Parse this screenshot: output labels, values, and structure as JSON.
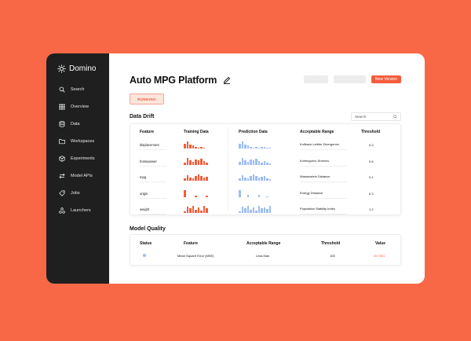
{
  "app": {
    "name": "Domino"
  },
  "sidebar": {
    "items": [
      {
        "label": "Search",
        "icon": "search-icon"
      },
      {
        "label": "Overview",
        "icon": "grid-icon"
      },
      {
        "label": "Data",
        "icon": "database-icon"
      },
      {
        "label": "Workspaces",
        "icon": "folder-icon"
      },
      {
        "label": "Experiments",
        "icon": "cube-icon"
      },
      {
        "label": "Model APIs",
        "icon": "arrows-icon"
      },
      {
        "label": "Jobs",
        "icon": "tag-icon"
      },
      {
        "label": "Launchers",
        "icon": "launcher-icon"
      }
    ]
  },
  "header": {
    "title": "Auto MPG Platform",
    "status": "RUNNING",
    "new_version_label": "New Version"
  },
  "data_drift": {
    "title": "Data Drift",
    "search_placeholder": "Search",
    "columns": {
      "feature": "Feature",
      "training": "Training Data",
      "prediction": "Prediction Data",
      "range": "Acceptable Range",
      "threshold": "Threshold"
    },
    "rows": [
      {
        "feature": "displacement",
        "range": "Kullback-Leibler Divergence",
        "threshold": "0.3",
        "training": [
          6,
          9,
          5,
          4,
          2,
          1,
          2,
          1
        ],
        "prediction": [
          6,
          9,
          5,
          4,
          2,
          1,
          2,
          1,
          2,
          2,
          1,
          1
        ]
      },
      {
        "feature": "horsepower",
        "range": "Kolmogorov-Smirnov",
        "threshold": "0.5",
        "training": [
          3,
          9,
          6,
          4,
          7,
          6,
          8,
          5,
          3
        ],
        "prediction": [
          4,
          9,
          6,
          4,
          7,
          6,
          8,
          5,
          3,
          5,
          3,
          2
        ]
      },
      {
        "feature": "mpg",
        "range": "Wasserstein Distance",
        "threshold": "0.1",
        "training": [
          3,
          7,
          4,
          3,
          6,
          8,
          6,
          4,
          5
        ],
        "prediction": [
          3,
          7,
          4,
          3,
          6,
          8,
          6,
          4,
          5,
          6,
          3,
          2
        ]
      },
      {
        "feature": "origin",
        "range": "Energy Distance",
        "threshold": "0.3",
        "training": [
          9,
          0,
          0,
          0,
          2,
          0,
          0,
          0,
          2
        ],
        "prediction": [
          9,
          0,
          0,
          3,
          0,
          0,
          0,
          3,
          0,
          0,
          1,
          0
        ]
      },
      {
        "feature": "weight",
        "range": "Population Stability Index",
        "threshold": "1.2",
        "training": [
          2,
          8,
          6,
          9,
          4,
          7,
          3,
          9,
          6
        ],
        "prediction": [
          2,
          8,
          6,
          9,
          4,
          7,
          3,
          9,
          6,
          7,
          5,
          9
        ]
      }
    ]
  },
  "model_quality": {
    "title": "Model Quality",
    "columns": {
      "status": "Status",
      "feature": "Feature",
      "range": "Acceptable Range",
      "threshold": "Threshold",
      "value": "Value"
    },
    "row": {
      "feature": "Mean Square Error (MSE)",
      "range": "Less than",
      "threshold": "100",
      "value": "26.7601"
    }
  },
  "colors": {
    "accent": "#f45d3c",
    "prediction": "#9cbcf5",
    "sidebar": "#1f1f1f",
    "background": "#f96846"
  }
}
